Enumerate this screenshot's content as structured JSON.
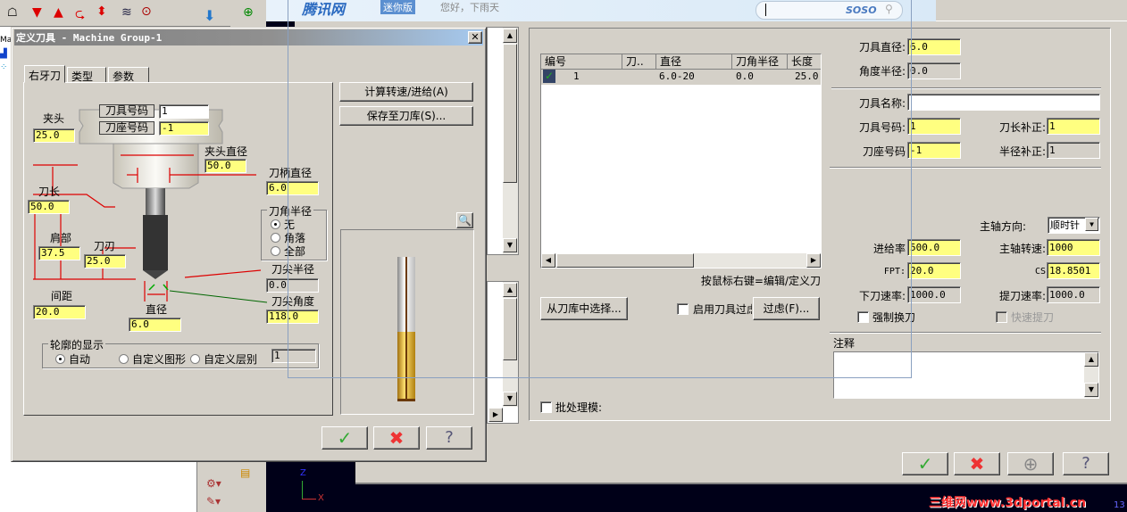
{
  "browser_bar": {
    "brand": "腾讯网",
    "badge": "迷你版",
    "greeting": "您好，下雨天",
    "search_logo": "SOSO"
  },
  "left_tree": {
    "item": "Ma"
  },
  "define_tool": {
    "title": "定义刀具 - Machine Group-1",
    "tabs": [
      "右牙刀",
      "类型",
      "参数"
    ],
    "calc_button": "计算转速/进给(A)",
    "save_button": "保存至刀库(S)...",
    "fields": {
      "tool_number": {
        "label": "刀具号码",
        "value": "1"
      },
      "holder_number": {
        "label": "刀座号码",
        "value": "-1"
      },
      "chuck": {
        "label": "夹头",
        "value": "25.0"
      },
      "chuck_dia": {
        "label": "夹头直径",
        "value": "50.0"
      },
      "shank_dia": {
        "label": "刀柄直径",
        "value": "6.0"
      },
      "tool_length": {
        "label": "刀长",
        "value": "50.0"
      },
      "shoulder": {
        "label": "肩部",
        "value": "37.5"
      },
      "flute": {
        "label": "刀刃",
        "value": "25.0"
      },
      "tip_radius": {
        "label": "刀尖半径",
        "value": "0.0"
      },
      "spacing": {
        "label": "间距",
        "value": "20.0"
      },
      "tip_angle": {
        "label": "刀尖角度",
        "value": "118.0"
      },
      "diameter": {
        "label": "直径",
        "value": "6.0"
      }
    },
    "corner_radius": {
      "title": "刀角半径",
      "options": [
        "无",
        "角落",
        "全部"
      ],
      "selected": 0
    },
    "profile_display": {
      "title": "轮廓的显示",
      "options": [
        "自动",
        "自定义图形",
        "自定义层别"
      ],
      "selected": 0,
      "level_value": "1"
    }
  },
  "tool_manager": {
    "list": {
      "columns": [
        "编号",
        "刀..",
        "直径",
        "刀角半径",
        "长度"
      ],
      "rows": [
        {
          "num": "1",
          "name": "",
          "dia": "6.0-20",
          "corner": "0.0",
          "len": "25.0"
        }
      ]
    },
    "hint": "按鼠标右键=编辑/定义刀",
    "library_button": "从刀库中选择...",
    "filter_check": "启用刀具过虑",
    "filter_button": "过虑(F)...",
    "batch_check": "批处理模:",
    "fields": {
      "tool_dia": {
        "label": "刀具直径:",
        "value": "6.0"
      },
      "angle_radius": {
        "label": "角度半径:",
        "value": "0.0"
      },
      "tool_name": {
        "label": "刀具名称:",
        "value": ""
      },
      "tool_number": {
        "label": "刀具号码:",
        "value": "1"
      },
      "length_offset": {
        "label": "刀长补正:",
        "value": "1"
      },
      "holder_number": {
        "label": "刀座号码",
        "value": "-1"
      },
      "radius_offset": {
        "label": "半径补正:",
        "value": "1"
      },
      "spindle_dir": {
        "label": "主轴方向:",
        "value": "顺时针"
      },
      "feed_rate": {
        "label": "进给率",
        "value": "500.0"
      },
      "spindle_speed": {
        "label": "主轴转速:",
        "value": "1000"
      },
      "fpt": {
        "label": "FPT:",
        "value": "20.0"
      },
      "cs": {
        "label": "CS",
        "value": "18.8501"
      },
      "plunge_rate": {
        "label": "下刀速率:",
        "value": "1000.0"
      },
      "retract_rate": {
        "label": "提刀速率:",
        "value": "1000.0"
      }
    },
    "force_change": "强制换刀",
    "rapid_retract": "快速提刀",
    "comment_label": "注释"
  },
  "axes": {
    "z": "Z",
    "x": "X"
  },
  "watermark": "三维网www.3dportal.cn",
  "corner_number": "13"
}
